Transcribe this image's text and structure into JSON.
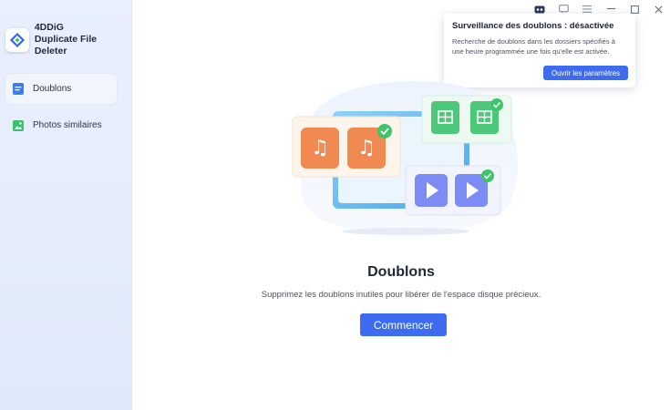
{
  "app": {
    "name_line1": "4DDiG",
    "name_line2": "Duplicate File Deleter"
  },
  "sidebar": {
    "items": [
      {
        "label": "Doublons",
        "icon": "file-icon",
        "active": true
      },
      {
        "label": "Photos similaires",
        "icon": "image-icon",
        "active": false
      }
    ]
  },
  "titlebar": {
    "icons": [
      "robot-icon",
      "chat-icon",
      "menu-icon",
      "minimize-icon",
      "maximize-icon",
      "close-icon"
    ]
  },
  "popup": {
    "title": "Surveillance des doublons : désactivée",
    "text": "Recherche de doublons dans les dossiers spécifiés à une heure programmée une fois qu'elle est activée.",
    "button": "Ouvrir les paramètres"
  },
  "main": {
    "title": "Doublons",
    "subtitle": "Supprimez les doublons inutiles pour libérer de l'espace disque précieux.",
    "start_button": "Commencer"
  },
  "colors": {
    "accent": "#3e6cf0",
    "music": "#f08a52",
    "sheet": "#4cc87a",
    "video": "#7d8cf4",
    "check": "#3fc46a"
  }
}
